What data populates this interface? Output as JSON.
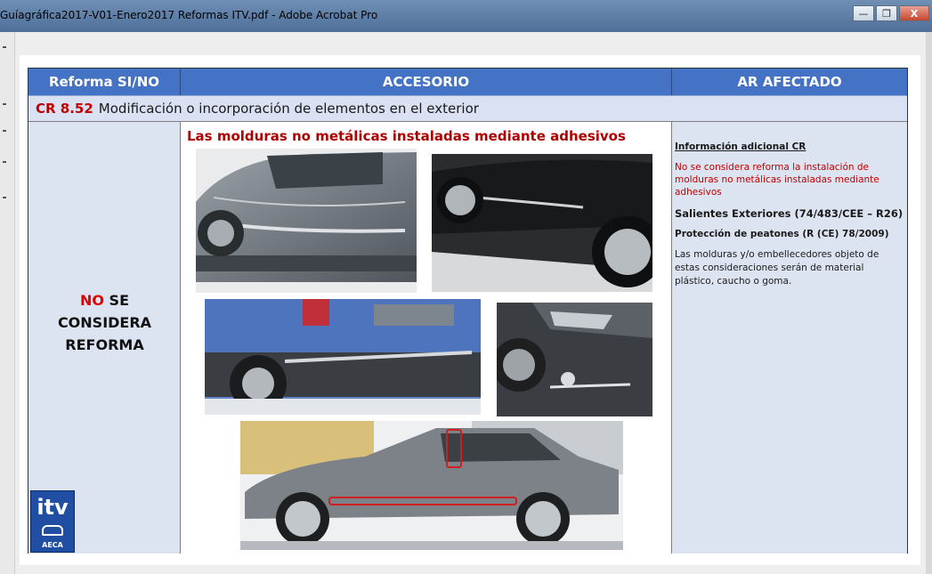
{
  "window": {
    "title": "Guíagráfica2017-V01-Enero2017 Reformas ITV.pdf - Adobe Acrobat Pro",
    "minimize_label": "—",
    "restore_label": "❐",
    "close_label": "X"
  },
  "table": {
    "headers": [
      "Reforma SI/NO",
      "ACCESORIO",
      "AR AFECTADO"
    ],
    "cr_code": "CR 8.52",
    "cr_title": "Modificación o incorporación de elementos en el exterior",
    "verdict": {
      "no": "NO",
      "line1_rest": " SE",
      "line2": "CONSIDERA",
      "line3": "REFORMA"
    },
    "logo": {
      "text": "itv",
      "sub": "AECA"
    },
    "accessory_title": "Las molduras no metálicas instaladas mediante adhesivos",
    "info": {
      "title": "Información adicional CR",
      "red_text": "No se considera reforma la instalación de molduras no metálicas instaladas mediante adhesivos",
      "bold1": "Salientes Exteriores  (74/483/CEE – R26)",
      "bold2": "Protección de peatones (R (CE) 78/2009)",
      "paragraph": "Las molduras y/o embellecedores objeto de estas consideraciones serán de material plástico, caucho o goma."
    }
  },
  "colors": {
    "header_blue": "#4472c4",
    "subrow": "#d9e1f2",
    "accent_red": "#c00000"
  }
}
